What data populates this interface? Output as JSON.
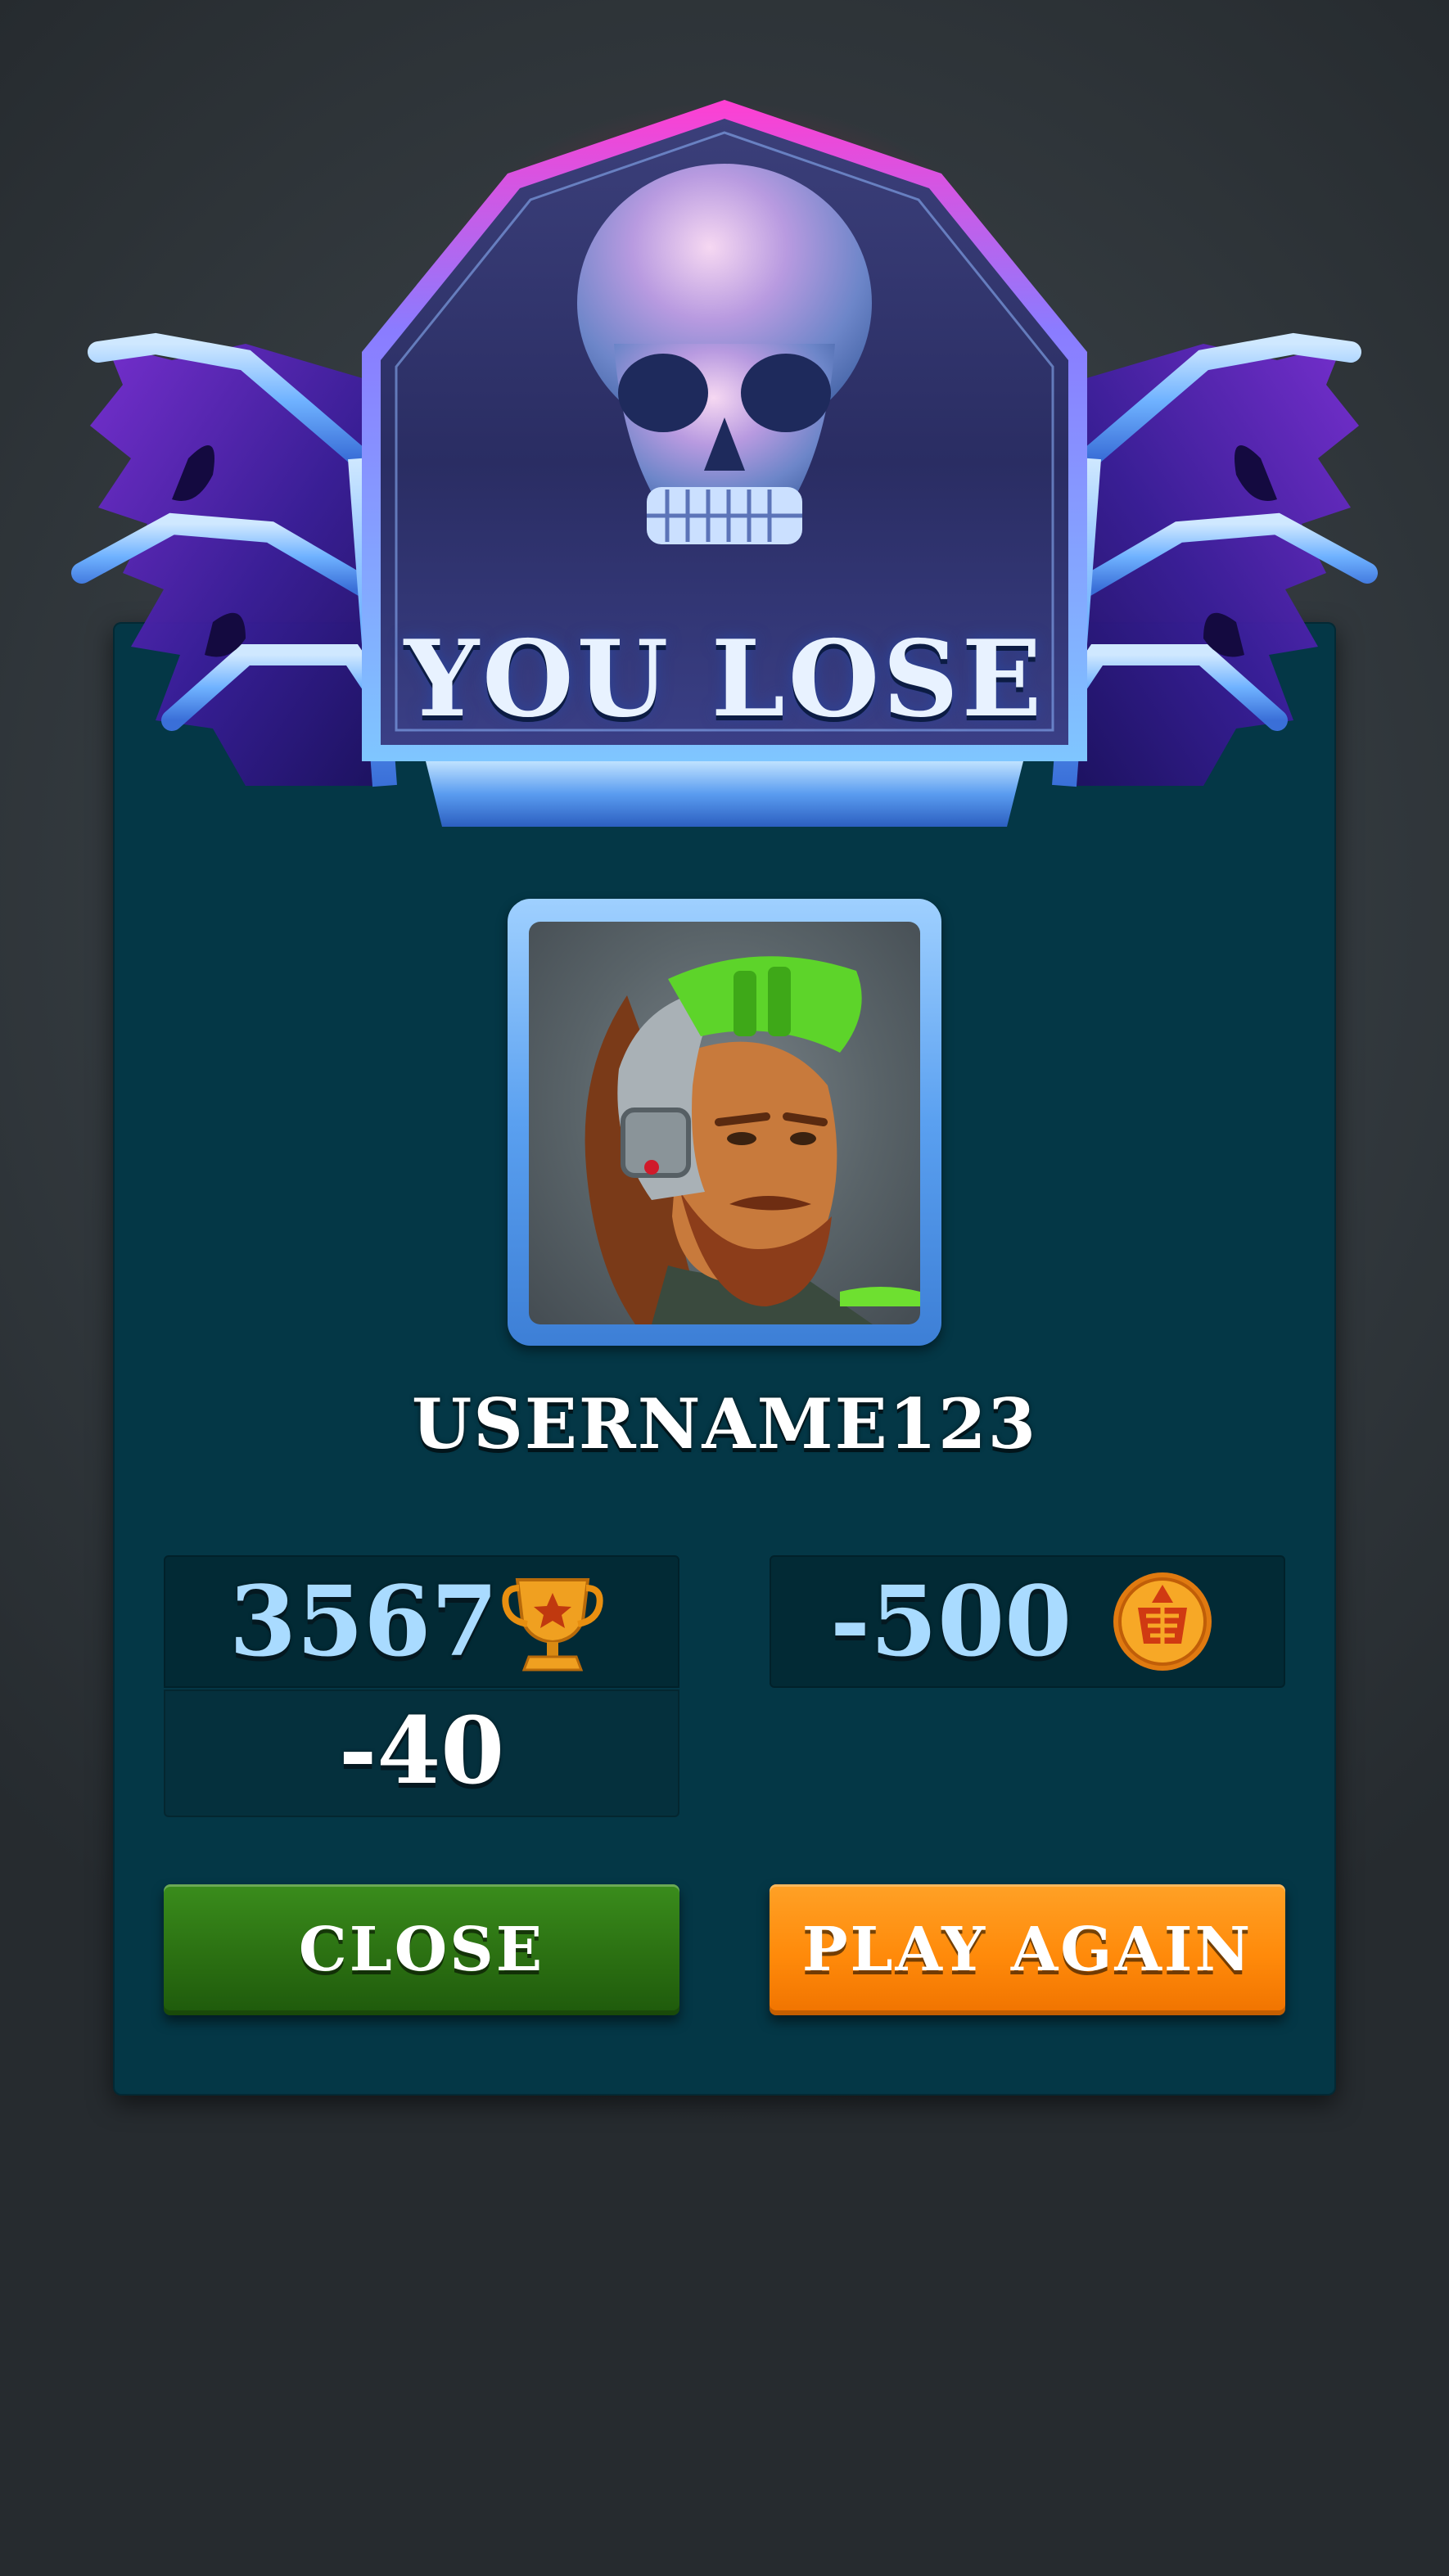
{
  "banner": {
    "title": "YOU LOSE",
    "icon": "skull-icon"
  },
  "player": {
    "username": "USERNAME123",
    "avatar": "helmeted-warrior-avatar"
  },
  "stats": {
    "trophies": "3567",
    "trophy_icon": "trophy-icon",
    "trophy_change": "-40",
    "coin_change": "-500",
    "coin_icon": "coin-icon"
  },
  "buttons": {
    "close_label": "CLOSE",
    "play_again_label": "PLAY AGAIN"
  },
  "colors": {
    "panel": "#043746",
    "stat_box": "#022a35",
    "number_blue": "#a9dbff",
    "close_green": "#2b7012",
    "play_orange": "#ff8a0a",
    "crest_glow": "#c42846"
  }
}
